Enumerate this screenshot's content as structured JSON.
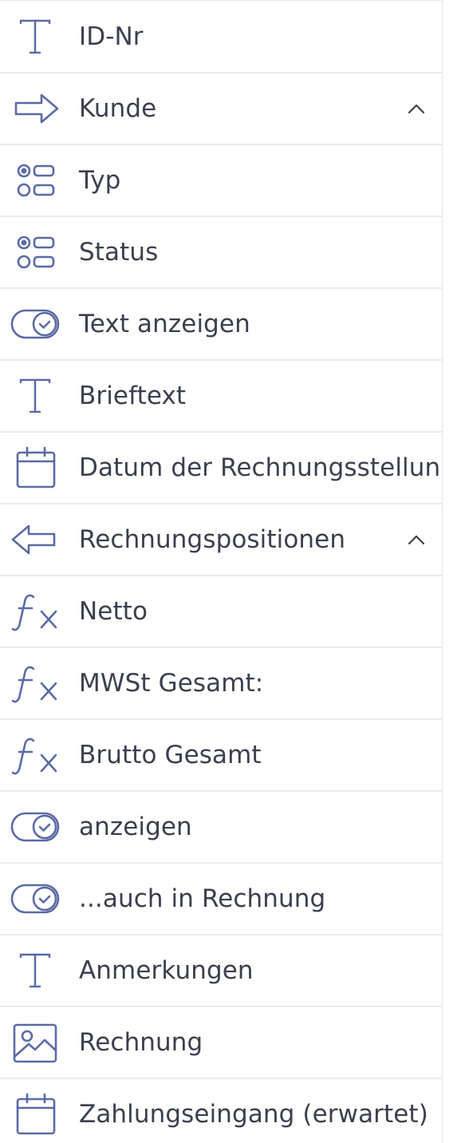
{
  "colors": {
    "icon": "#5b6aa6",
    "text": "#3b3f4e",
    "divider": "#e9ebf1"
  },
  "fields": [
    {
      "label": "ID-Nr",
      "icon": "text-icon",
      "expandable": false
    },
    {
      "label": "Kunde",
      "icon": "arrow-right-icon",
      "expandable": true
    },
    {
      "label": "Typ",
      "icon": "options-icon",
      "expandable": false
    },
    {
      "label": "Status",
      "icon": "options-icon",
      "expandable": false
    },
    {
      "label": "Text anzeigen",
      "icon": "toggle-check-icon",
      "expandable": false
    },
    {
      "label": "Brieftext",
      "icon": "text-icon",
      "expandable": false
    },
    {
      "label": "Datum der Rechnungsstellung",
      "icon": "calendar-icon",
      "expandable": false
    },
    {
      "label": "Rechnungspositionen",
      "icon": "arrow-left-icon",
      "expandable": true
    },
    {
      "label": "Netto",
      "icon": "formula-icon",
      "expandable": false
    },
    {
      "label": "MWSt Gesamt:",
      "icon": "formula-icon",
      "expandable": false
    },
    {
      "label": "Brutto Gesamt",
      "icon": "formula-icon",
      "expandable": false
    },
    {
      "label": "anzeigen",
      "icon": "toggle-check-icon",
      "expandable": false
    },
    {
      "label": "...auch in Rechnung",
      "icon": "toggle-check-icon",
      "expandable": false
    },
    {
      "label": "Anmerkungen",
      "icon": "text-icon",
      "expandable": false
    },
    {
      "label": "Rechnung",
      "icon": "image-icon",
      "expandable": false
    },
    {
      "label": "Zahlungseingang (erwartet)",
      "icon": "calendar-icon",
      "expandable": false
    }
  ]
}
